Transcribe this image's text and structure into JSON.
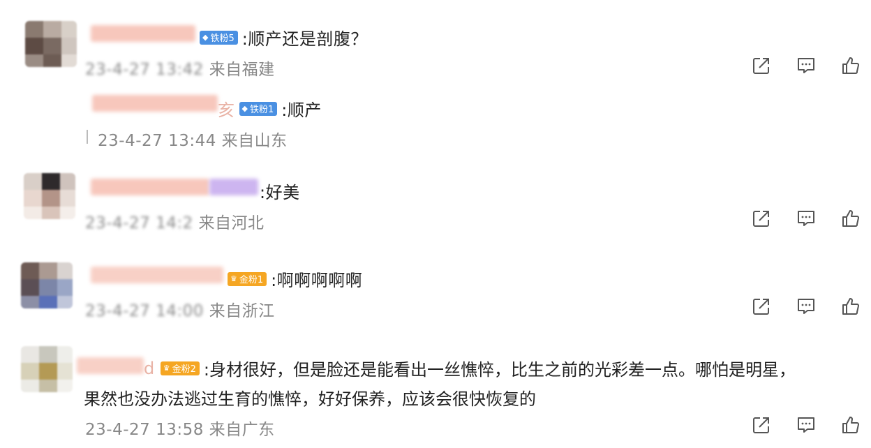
{
  "comments": [
    {
      "badge": "铁粉5",
      "badge_color": "#4a90e2",
      "text": ":顺产还是剖腹？",
      "time": "23-4-27 13:42",
      "location": "来自福建"
    },
    {
      "name_suffix": "亥",
      "badge": "铁粉1",
      "badge_color": "#4a90e2",
      "text": ":顺产",
      "time": "23-4-27 13:44",
      "location": "来自山东"
    },
    {
      "text": ":好美",
      "time": "23-4-27 14:2",
      "location": "来自河北"
    },
    {
      "badge": "金粉1",
      "badge_color": "#f5a623",
      "text": ":啊啊啊啊啊",
      "time": "23-4-27 14:00",
      "location": "来自浙江"
    },
    {
      "name_suffix": "d",
      "badge": "金粉2",
      "badge_color": "#f5a623",
      "text": ":身材很好，但是脸还是能看出一丝憔悴，比生之前的光彩差一点。哪怕是明星，",
      "text2": "果然也没办法逃过生育的憔悴，好好保养，应该会很快恢复的",
      "time": "23-4-27 13:58",
      "location": "来自广东"
    }
  ],
  "icons": {
    "share": "share-icon",
    "comment": "comment-icon",
    "like": "like-icon"
  }
}
